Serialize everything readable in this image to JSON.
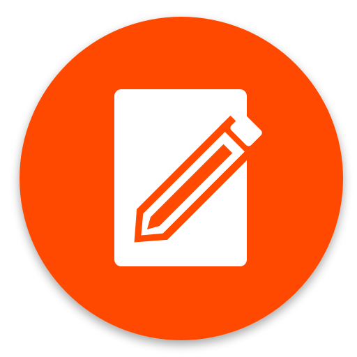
{
  "icon": {
    "name": "edit-note-icon",
    "description_name": "compose-icon",
    "colors": {
      "background": "#ffffff",
      "badge_fill": "#ff4a00",
      "glyph_fill": "#ffffff",
      "shadow": "#000000"
    }
  }
}
